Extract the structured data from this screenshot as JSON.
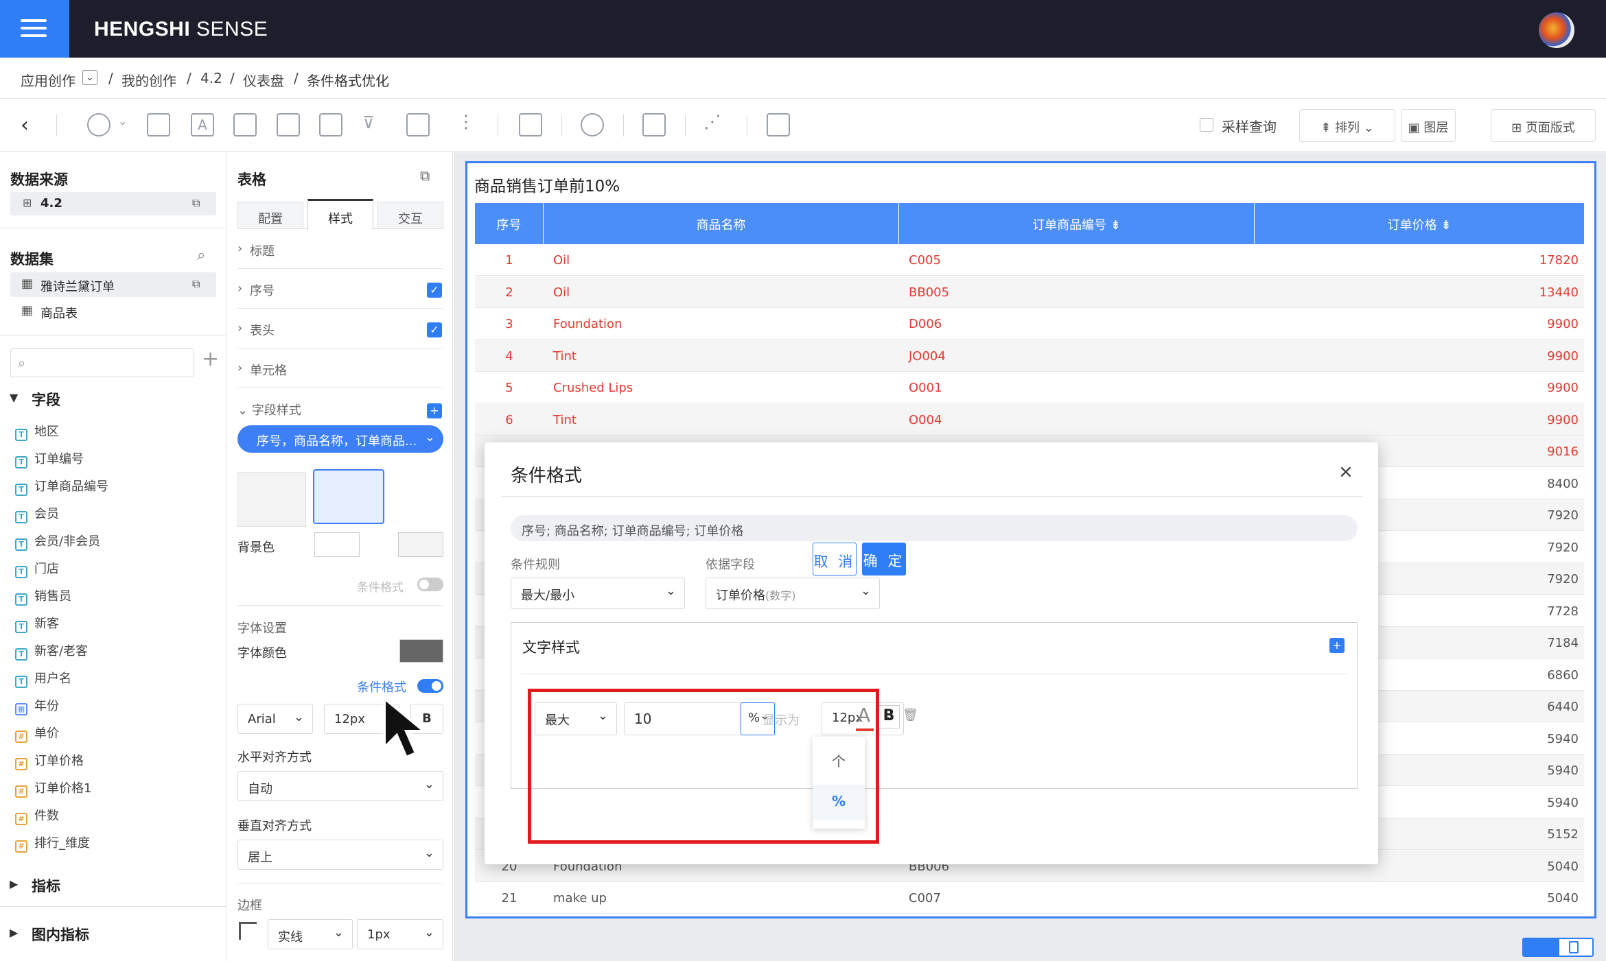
{
  "app": {
    "brand_bold": "HENGSHI",
    "brand_light": " SENSE"
  },
  "breadcrumb": {
    "root": "应用创作",
    "sep": "/",
    "items": [
      "我的创作",
      "4.2",
      "仪表盘",
      "条件格式优化"
    ]
  },
  "toolbar": {
    "sample_query": "采样查询",
    "arrange": "排列",
    "layers": "图层",
    "page_layout": "页面版式"
  },
  "left": {
    "datasource_title": "数据来源",
    "datasource_item": "4.2",
    "dataset_title": "数据集",
    "datasets": [
      "雅诗兰黛订单",
      "商品表"
    ],
    "fields_title": "字段",
    "fields": [
      {
        "label": "地区",
        "type": "T"
      },
      {
        "label": "订单编号",
        "type": "T"
      },
      {
        "label": "订单商品编号",
        "type": "T"
      },
      {
        "label": "会员",
        "type": "T"
      },
      {
        "label": "会员/非会员",
        "type": "T"
      },
      {
        "label": "门店",
        "type": "T"
      },
      {
        "label": "销售员",
        "type": "T"
      },
      {
        "label": "新客",
        "type": "T"
      },
      {
        "label": "新客/老客",
        "type": "T"
      },
      {
        "label": "用户名",
        "type": "T"
      },
      {
        "label": "年份",
        "type": "date"
      },
      {
        "label": "单价",
        "type": "#"
      },
      {
        "label": "订单价格",
        "type": "#"
      },
      {
        "label": "订单价格1",
        "type": "#"
      },
      {
        "label": "件数",
        "type": "#"
      },
      {
        "label": "排行_维度",
        "type": "#"
      }
    ],
    "metrics_title": "指标",
    "chart_metrics_title": "图内指标"
  },
  "mid": {
    "title": "表格",
    "tabs": [
      "配置",
      "样式",
      "交互"
    ],
    "sections": [
      "标题",
      "序号",
      "表头",
      "单元格",
      "字段样式"
    ],
    "field_selector": "序号，商品名称，订单商品...",
    "bg_color_label": "背景色",
    "cond_format_disabled": "条件格式",
    "font_settings": "字体设置",
    "font_color": "字体颜色",
    "cond_format": "条件格式",
    "font_family": "Arial",
    "font_size": "12px",
    "bold": "B",
    "h_align_label": "水平对齐方式",
    "h_align": "自动",
    "v_align_label": "垂直对齐方式",
    "v_align": "居上",
    "border_label": "边框",
    "border_style": "实线",
    "border_width": "1px"
  },
  "card": {
    "title": "商品销售订单前10%",
    "headers": [
      "序号",
      "商品名称",
      "订单商品编号",
      "订单价格"
    ],
    "rows": [
      {
        "idx": "1",
        "name": "Oil",
        "code": "C005",
        "price": "17820",
        "hl": true
      },
      {
        "idx": "2",
        "name": "Oil",
        "code": "BB005",
        "price": "13440",
        "hl": true
      },
      {
        "idx": "3",
        "name": "Foundation",
        "code": "D006",
        "price": "9900",
        "hl": true
      },
      {
        "idx": "4",
        "name": "Tint",
        "code": "JO004",
        "price": "9900",
        "hl": true
      },
      {
        "idx": "5",
        "name": "Crushed Lips",
        "code": "O001",
        "price": "9900",
        "hl": true
      },
      {
        "idx": "6",
        "name": "Tint",
        "code": "O004",
        "price": "9900",
        "hl": true
      }
    ],
    "hidden_prices": [
      "9016",
      "8400",
      "7920",
      "7920",
      "7920",
      "7728",
      "7184",
      "6860",
      "6440",
      "5940",
      "5940",
      "5940",
      "5152"
    ],
    "tail_rows": [
      {
        "idx": "20",
        "name": "Foundation",
        "code": "BB006",
        "price": "5040"
      },
      {
        "idx": "21",
        "name": "make up",
        "code": "C007",
        "price": "5040"
      }
    ]
  },
  "dialog": {
    "title": "条件格式",
    "close": "×",
    "fields": "序号; 商品名称; 订单商品编号; 订单价格",
    "rule_label": "条件规则",
    "rule_value": "最大/最小",
    "basis_label": "依据字段",
    "basis_value": "订单价格",
    "basis_type": "(数字)",
    "text_style": "文字样式",
    "mode": "最大",
    "amount": "10",
    "unit": "%",
    "display_as": "显示为",
    "size": "12px",
    "font_color_glyph": "A",
    "bold": "B",
    "unit_options": [
      "个",
      "%"
    ],
    "cancel": "取 消",
    "ok": "确 定"
  },
  "colors": {
    "accent": "#2f7ef6",
    "topbar": "#1c1e2b",
    "header": "#4b8ef7",
    "highlight_text": "#e13b32",
    "annotation": "#e11b1b"
  }
}
